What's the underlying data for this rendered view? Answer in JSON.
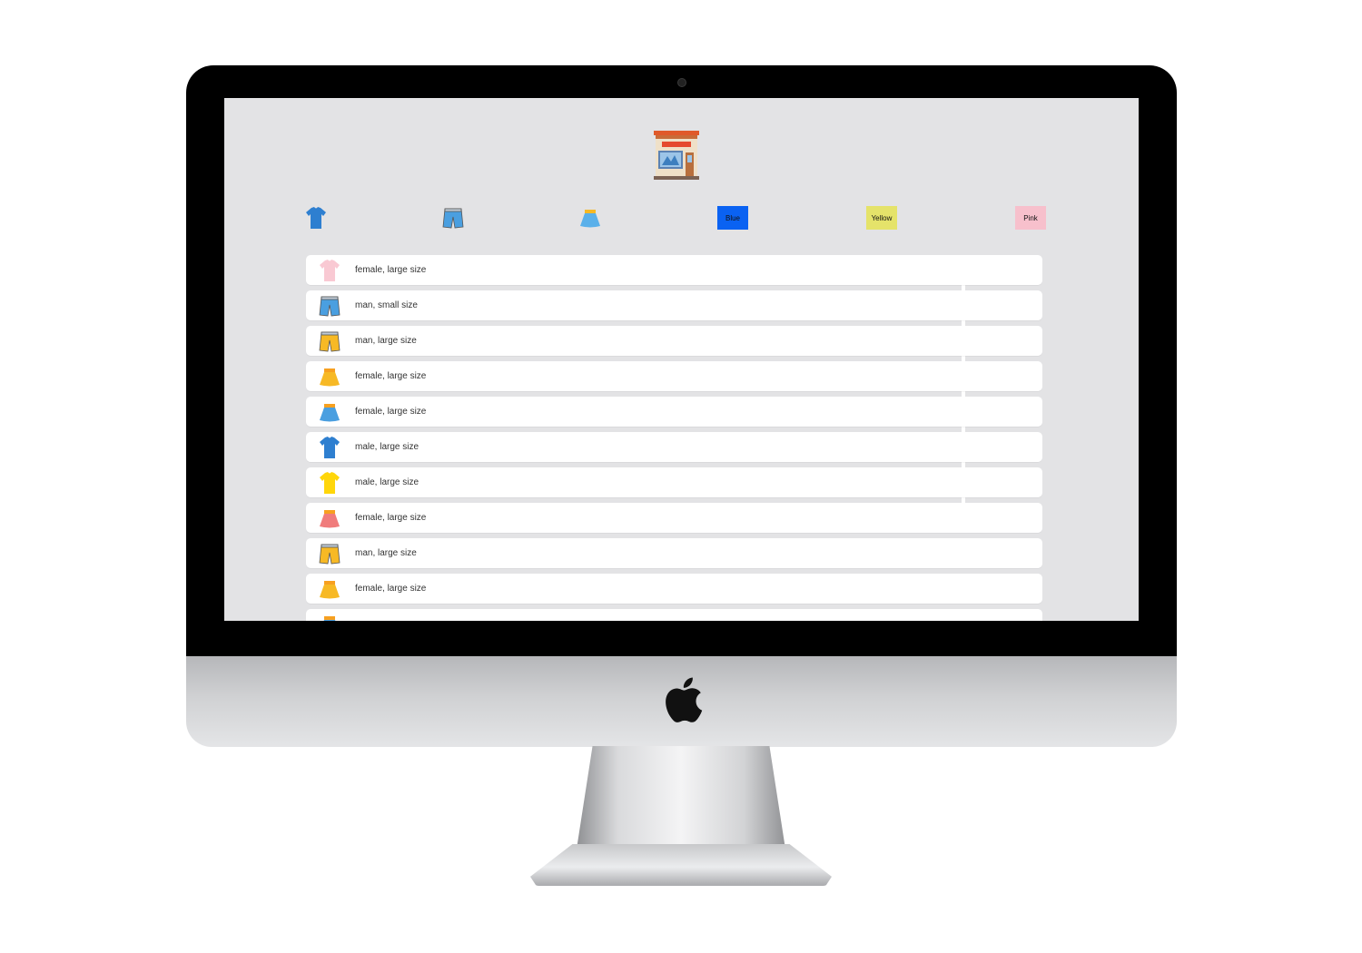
{
  "filters": {
    "shirt": {
      "icon": "tshirt-icon",
      "color": "#2e7fd0"
    },
    "shorts": {
      "icon": "shorts-icon",
      "color": "#4a9fe0"
    },
    "skirt": {
      "icon": "skirt-icon",
      "color": "#5ab0ea"
    },
    "colors": [
      {
        "label": "Blue",
        "bg": "#0a62f2"
      },
      {
        "label": "Yellow",
        "bg": "#e5e36a"
      },
      {
        "label": "Pink",
        "bg": "#f7c0cc"
      }
    ]
  },
  "items": [
    {
      "icon": "tshirt-icon",
      "color": "#f9c9d3",
      "label": "female, large size"
    },
    {
      "icon": "shorts-icon",
      "color": "#4a9fe0",
      "label": "man, small size"
    },
    {
      "icon": "shorts-icon",
      "color": "#f7b925",
      "label": "man, large size"
    },
    {
      "icon": "skirt-icon",
      "color": "#f7b925",
      "label": "female, large size"
    },
    {
      "icon": "skirt-icon",
      "color": "#4a9fe0",
      "label": "female, large size"
    },
    {
      "icon": "tshirt-icon",
      "color": "#2e7fd0",
      "label": "male, large size"
    },
    {
      "icon": "tshirt-icon",
      "color": "#ffd60a",
      "label": "male, large size"
    },
    {
      "icon": "skirt-icon",
      "color": "#f07c7c",
      "label": "female, large size"
    },
    {
      "icon": "shorts-icon",
      "color": "#f7b925",
      "label": "man, large size"
    },
    {
      "icon": "skirt-icon",
      "color": "#f7b925",
      "label": "female, large size"
    },
    {
      "icon": "skirt-icon",
      "color": "#4a9fe0",
      "label": ""
    }
  ]
}
